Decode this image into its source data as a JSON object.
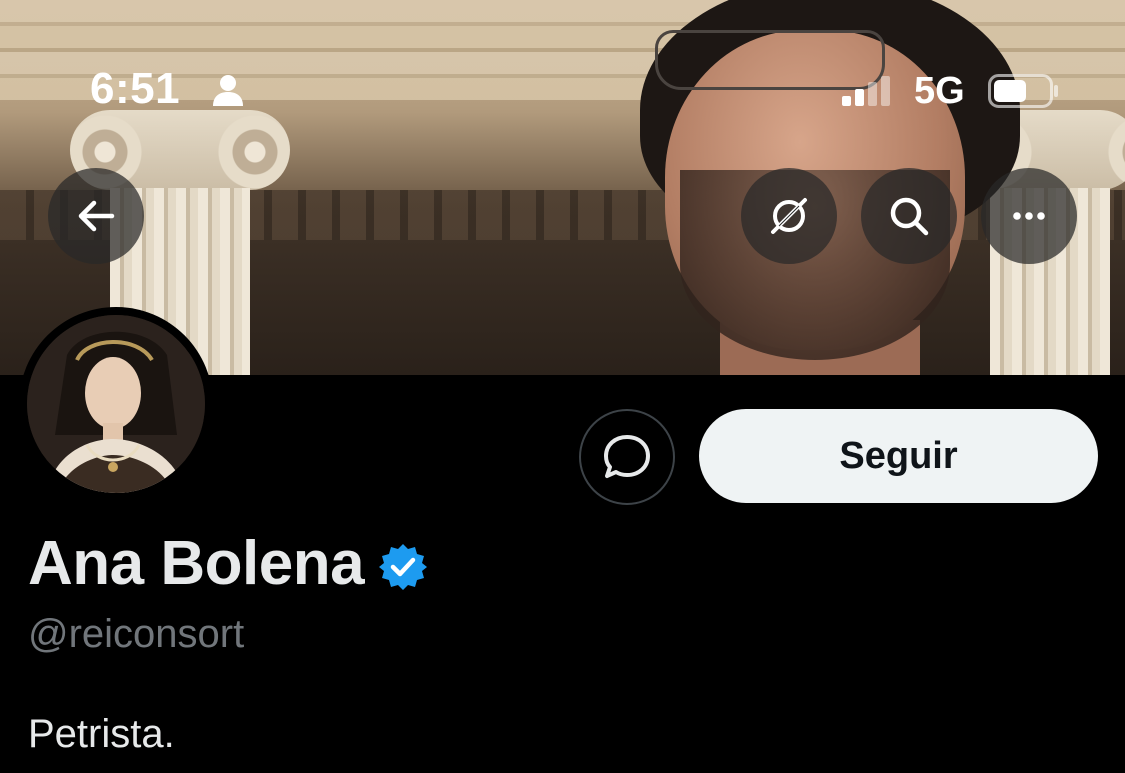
{
  "status_bar": {
    "time": "6:51",
    "network": "5G"
  },
  "icons": {
    "back": "arrow-left-icon",
    "grok": "grok-icon",
    "search": "search-icon",
    "more": "more-icon",
    "message": "message-icon",
    "verified": "verified-badge-icon"
  },
  "profile": {
    "display_name": "Ana Bolena",
    "handle": "@reiconsort",
    "bio": "Petrista.",
    "verified": true
  },
  "actions": {
    "follow_label": "Seguir"
  },
  "colors": {
    "background": "#000000",
    "follow_button_bg": "#eff3f4",
    "verified_blue": "#1d9bf0",
    "handle_gray": "#71767b",
    "text": "#e7e9ea"
  }
}
